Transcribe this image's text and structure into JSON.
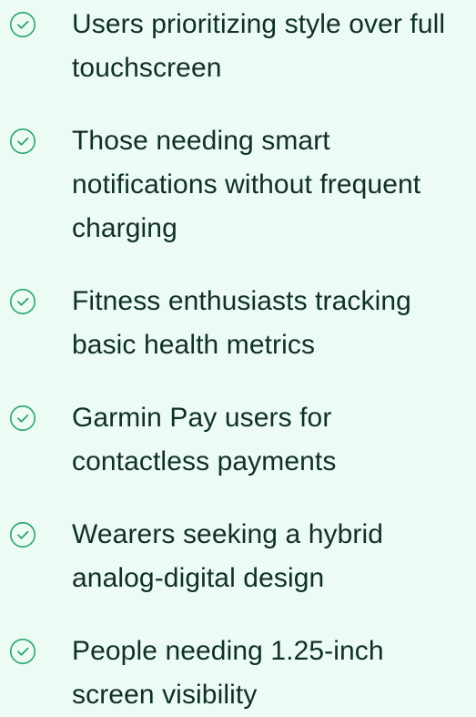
{
  "colors": {
    "background": "#ecfbf4",
    "text": "#0f2f29",
    "check": "#2aa46d"
  },
  "list": {
    "icon": "check-circle-icon",
    "items": [
      {
        "label": "Users prioritizing style over full touchscreen"
      },
      {
        "label": "Those needing smart notifications without frequent charging"
      },
      {
        "label": "Fitness enthusiasts tracking basic health metrics"
      },
      {
        "label": "Garmin Pay users for contactless payments"
      },
      {
        "label": "Wearers seeking a hybrid analog-digital design"
      },
      {
        "label": "People needing 1.25-inch screen visibility"
      }
    ]
  }
}
